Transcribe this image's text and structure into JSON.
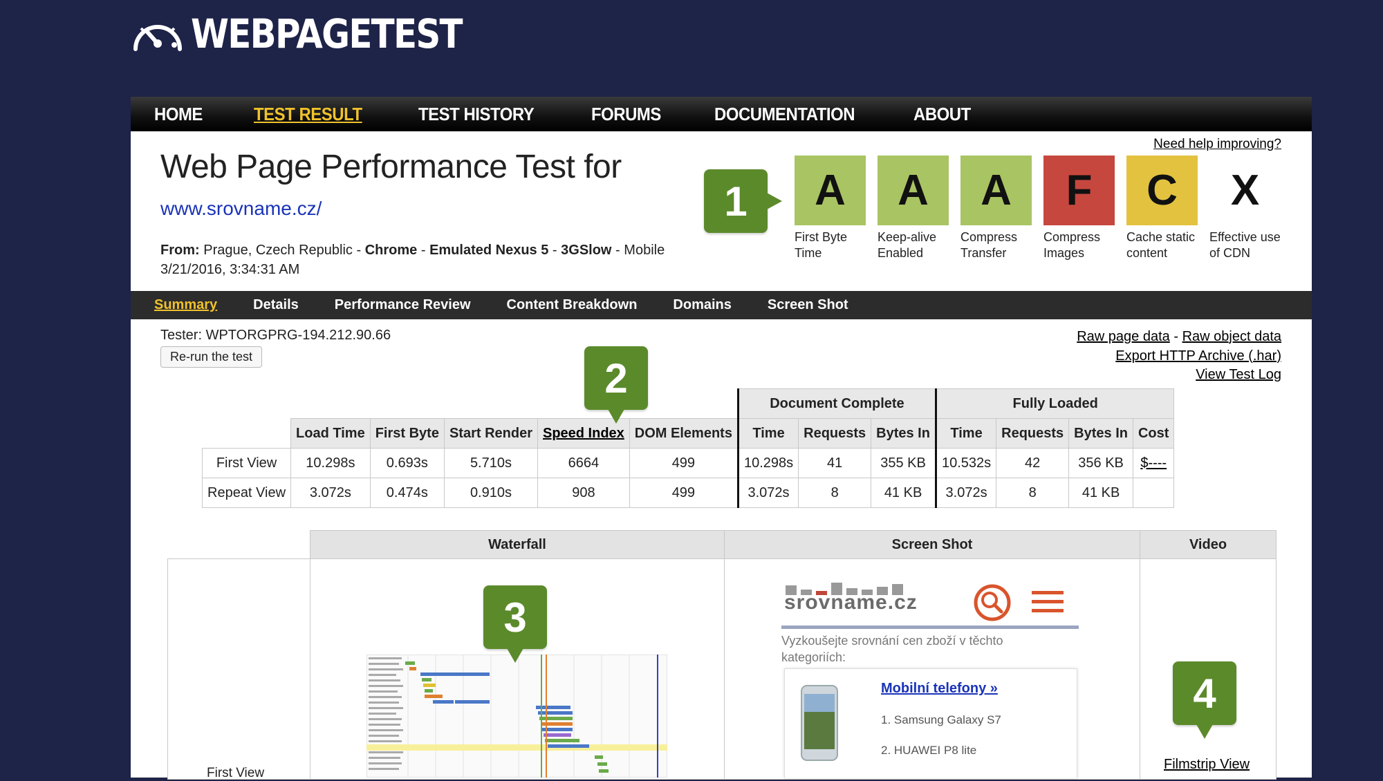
{
  "logo": {
    "text": "WEBPAGETEST",
    "icon": "speedometer-icon"
  },
  "nav": {
    "items": [
      {
        "label": "HOME",
        "active": false
      },
      {
        "label": "TEST RESULT",
        "active": true
      },
      {
        "label": "TEST HISTORY",
        "active": false
      },
      {
        "label": "FORUMS",
        "active": false
      },
      {
        "label": "DOCUMENTATION",
        "active": false
      },
      {
        "label": "ABOUT",
        "active": false
      }
    ]
  },
  "header": {
    "title": "Web Page Performance Test for",
    "url": "www.srovname.cz/",
    "from_label": "From:",
    "from_location": "Prague, Czech Republic",
    "browser": "Chrome",
    "device": "Emulated Nexus 5",
    "network": "3GSlow",
    "platform": "Mobile",
    "datetime": "3/21/2016, 3:34:31 AM",
    "help_link": "Need help improving?"
  },
  "grades": [
    {
      "grade": "A",
      "label": "First Byte Time",
      "color": "#a9c462"
    },
    {
      "grade": "A",
      "label": "Keep-alive Enabled",
      "color": "#a9c462"
    },
    {
      "grade": "A",
      "label": "Compress Transfer",
      "color": "#a9c462"
    },
    {
      "grade": "F",
      "label": "Compress Images",
      "color": "#c6473e"
    },
    {
      "grade": "C",
      "label": "Cache static content",
      "color": "#e3c240"
    },
    {
      "grade": "X",
      "label": "Effective use of CDN",
      "color": "#ffffff"
    }
  ],
  "callouts": [
    "1",
    "2",
    "3",
    "4"
  ],
  "subnav": {
    "items": [
      {
        "label": "Summary",
        "active": true
      },
      {
        "label": "Details",
        "active": false
      },
      {
        "label": "Performance Review",
        "active": false
      },
      {
        "label": "Content Breakdown",
        "active": false
      },
      {
        "label": "Domains",
        "active": false
      },
      {
        "label": "Screen Shot",
        "active": false
      }
    ]
  },
  "tester": "Tester: WPTORGPRG-194.212.90.66",
  "rerun_label": "Re-run the test",
  "links": {
    "raw_page": "Raw page data",
    "separator": "-",
    "raw_object": "Raw object data",
    "export_har": "Export HTTP Archive (.har)",
    "view_log": "View Test Log"
  },
  "results": {
    "group_headers": {
      "document_complete": "Document Complete",
      "fully_loaded": "Fully Loaded"
    },
    "columns": [
      "Load Time",
      "First Byte",
      "Start Render",
      "Speed Index",
      "DOM Elements",
      "Time",
      "Requests",
      "Bytes In",
      "Time",
      "Requests",
      "Bytes In",
      "Cost"
    ],
    "rows": [
      {
        "label": "First View",
        "values": [
          "10.298s",
          "0.693s",
          "5.710s",
          "6664",
          "499",
          "10.298s",
          "41",
          "355 KB",
          "10.532s",
          "42",
          "356 KB",
          "$----"
        ]
      },
      {
        "label": "Repeat View",
        "values": [
          "3.072s",
          "0.474s",
          "0.910s",
          "908",
          "499",
          "3.072s",
          "8",
          "41 KB",
          "3.072s",
          "8",
          "41 KB",
          ""
        ]
      }
    ]
  },
  "lower": {
    "headers": {
      "waterfall": "Waterfall",
      "screenshot": "Screen Shot",
      "video": "Video"
    },
    "row_label": "First View",
    "screenshot": {
      "brand": "srovname.cz",
      "tagline": "Vyzkoušejte srovnání cen zboží v těchto kategoriích:",
      "category_link": "Mobilní telefony »",
      "item1": "1. Samsung Galaxy S7",
      "item2": "2. HUAWEI P8 lite"
    },
    "filmstrip_link": "Filmstrip View"
  },
  "colors": {
    "background": "#1e2348",
    "active_nav": "#f0c22c",
    "callout": "#5b8a2b",
    "link_blue": "#1a33b8"
  }
}
